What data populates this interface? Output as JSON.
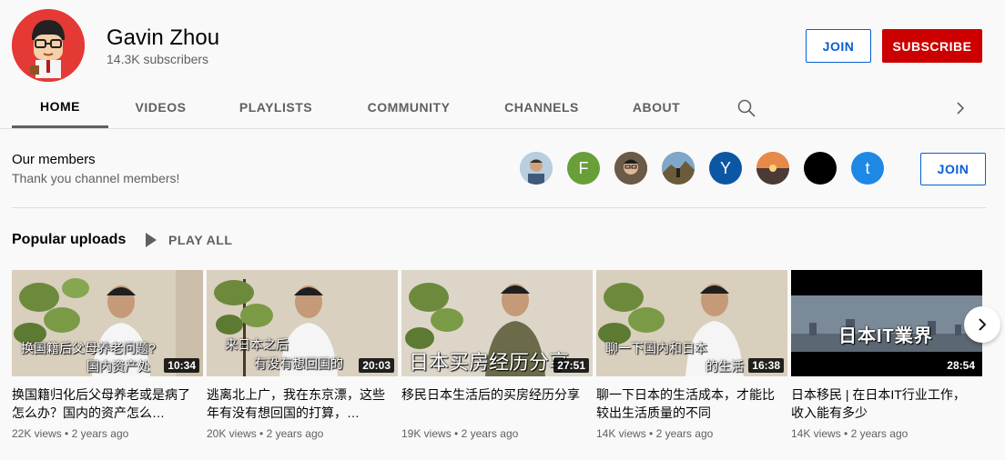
{
  "channel": {
    "name": "Gavin Zhou",
    "subscribers": "14.3K subscribers",
    "join_label": "JOIN",
    "subscribe_label": "SUBSCRIBE"
  },
  "tabs": [
    {
      "label": "HOME",
      "active": true
    },
    {
      "label": "VIDEOS"
    },
    {
      "label": "PLAYLISTS"
    },
    {
      "label": "COMMUNITY"
    },
    {
      "label": "CHANNELS"
    },
    {
      "label": "ABOUT"
    }
  ],
  "icons": {
    "search": "search-icon",
    "next_tab": "chevron-right-icon"
  },
  "members": {
    "title": "Our members",
    "subtitle": "Thank you channel members!",
    "join_label": "JOIN",
    "avatars": [
      {
        "type": "photo",
        "color": "#9ab7d3"
      },
      {
        "type": "letter",
        "letter": "F",
        "color": "#689f38"
      },
      {
        "type": "photo",
        "color": "#5d4b3a"
      },
      {
        "type": "photo",
        "color": "#8d7b4f"
      },
      {
        "type": "letter",
        "letter": "Y",
        "color": "#0b57a4"
      },
      {
        "type": "photo",
        "color": "#b0633a"
      },
      {
        "type": "solid",
        "color": "#000000"
      },
      {
        "type": "letter",
        "letter": "t",
        "color": "#1e88e5"
      }
    ]
  },
  "popular": {
    "title": "Popular uploads",
    "play_all_label": "PLAY ALL",
    "videos": [
      {
        "title": "换国籍归化后父母养老或是病了怎么办？国内的资产怎么…",
        "views": "22K views",
        "age": "2 years ago",
        "duration": "10:34",
        "overlay": [
          "换国籍后父母养老问题?",
          "国内资产处"
        ]
      },
      {
        "title": "逃离北上广，我在东京漂，这些年有没有想回国的打算，…",
        "views": "20K views",
        "age": "2 years ago",
        "duration": "20:03",
        "overlay": [
          "来日本之后",
          "有没有想回国的"
        ]
      },
      {
        "title": "移民日本生活后的买房经历分享",
        "views": "19K views",
        "age": "2 years ago",
        "duration": "27:51",
        "overlay": [
          "日本买房经历分享"
        ]
      },
      {
        "title": "聊一下日本的生活成本，才能比较出生活质量的不同",
        "views": "14K views",
        "age": "2 years ago",
        "duration": "16:38",
        "overlay": [
          "聊一下国内和日本",
          "的生活"
        ]
      },
      {
        "title": "日本移民 | 在日本IT行业工作，收入能有多少",
        "views": "14K views",
        "age": "2 years ago",
        "duration": "28:54",
        "overlay": [
          "日本IT業界"
        ]
      }
    ]
  }
}
